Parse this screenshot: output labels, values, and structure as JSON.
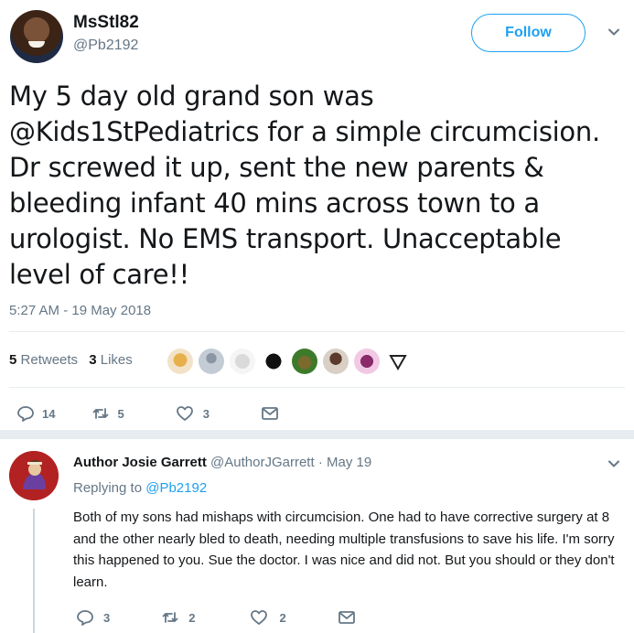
{
  "tweet": {
    "display_name": "MsStl82",
    "handle": "@Pb2192",
    "follow_label": "Follow",
    "text": "My 5 day old grand son was @Kids1StPediatrics for a simple circumcision. Dr screwed it up, sent the new parents & bleeding infant 40 mins across town to a urologist. No EMS transport. Unacceptable level of care!!",
    "timestamp": "5:27 AM - 19 May 2018",
    "retweets_count": "5",
    "retweets_label": "Retweets",
    "likes_count": "3",
    "likes_label": "Likes",
    "actions": {
      "replies": "14",
      "retweets": "5",
      "likes": "3"
    }
  },
  "reply": {
    "author_name": "Author Josie Garrett",
    "author_handle": "@AuthorJGarrett",
    "separator": "·",
    "date": "May 19",
    "replying_label": "Replying to",
    "replying_handle": "@Pb2192",
    "text": "Both of my sons had mishaps with circumcision. One had to have corrective surgery at 8 and the other nearly bled to death, needing multiple transfusions to save his life. I'm sorry this happened to you. Sue the doctor. I was nice and did not. But you should or they don't learn.",
    "actions": {
      "replies": "3",
      "retweets": "2",
      "likes": "2"
    }
  },
  "icons": {
    "reply": "reply-icon",
    "retweet": "retweet-icon",
    "like": "heart-icon",
    "message": "envelope-icon",
    "more": "chevron-down-icon"
  },
  "colors": {
    "accent": "#1da1f2",
    "muted": "#657786",
    "text": "#14171a",
    "divider": "#e6ecf0"
  }
}
